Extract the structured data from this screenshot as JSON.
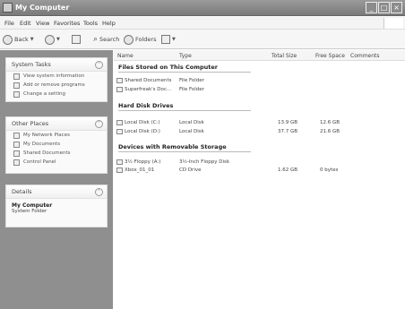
{
  "window": {
    "title": "My Computer",
    "icon": "computer-icon",
    "controls": [
      "_",
      "□",
      "×"
    ]
  },
  "menu": {
    "items": [
      "File",
      "Edit",
      "View",
      "Favorites",
      "Tools",
      "Help"
    ]
  },
  "toolbar": {
    "back": "Back",
    "search": "Search",
    "folders": "Folders",
    "views_icon": "views-icon"
  },
  "left": {
    "system_tasks": {
      "header": "System Tasks",
      "items": [
        "View system information",
        "Add or remove programs",
        "Change a setting"
      ]
    },
    "other_places": {
      "header": "Other Places",
      "items": [
        "My Network Places",
        "My Documents",
        "Shared Documents",
        "Control Panel"
      ]
    },
    "details": {
      "header": "Details",
      "name": "My Computer",
      "sub": "System Folder"
    }
  },
  "main": {
    "columns": [
      "Name",
      "Type",
      "Total Size",
      "Free Space",
      "Comments"
    ],
    "groups": [
      {
        "title": "Files Stored on This Computer",
        "rows": [
          {
            "name": "Shared Documents",
            "type": "File Folder",
            "total": "",
            "free": ""
          },
          {
            "name": "Superfreak's Doc...",
            "type": "File Folder",
            "total": "",
            "free": ""
          }
        ]
      },
      {
        "title": "Hard Disk Drives",
        "rows": [
          {
            "name": "Local Disk (C:)",
            "type": "Local Disk",
            "total": "13.9 GB",
            "free": "12.6 GB"
          },
          {
            "name": "Local Disk (D:)",
            "type": "Local Disk",
            "total": "37.7 GB",
            "free": "21.6 GB"
          }
        ]
      },
      {
        "title": "Devices with Removable Storage",
        "rows": [
          {
            "name": "3½ Floppy (A:)",
            "type": "3½-Inch Floppy Disk",
            "total": "",
            "free": ""
          },
          {
            "name": "Xbox_01_01",
            "type": "CD Drive",
            "total": "1.62 GB",
            "free": "0 bytes"
          }
        ]
      }
    ]
  },
  "colors": {
    "title_bar": "#8a8a8a",
    "left_pane": "#8f8f8f",
    "panel_bg": "#fafafa"
  }
}
